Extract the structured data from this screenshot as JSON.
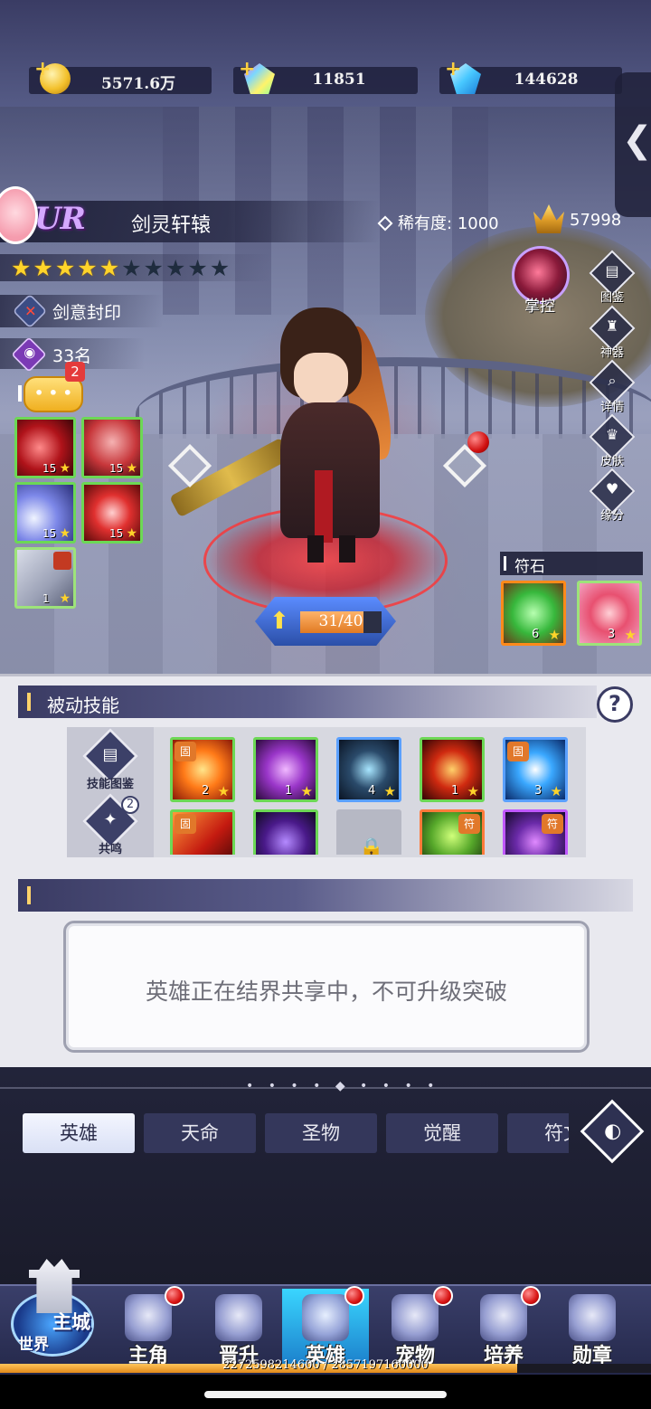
{
  "currency": {
    "gold": "5571.6万",
    "diamond_rainbow": "11851",
    "diamond_blue": "144628"
  },
  "hero": {
    "grade": "UR",
    "name": "剑灵轩辕",
    "rarity_label": "稀有度:",
    "rarity_value": "1000",
    "power": "57998",
    "stars_filled": 5,
    "stars_total": 10,
    "seal": "剑意封印",
    "rank": "33名",
    "chat_badge": "2"
  },
  "active_skills": [
    {
      "level": "15",
      "icon": "red-slash"
    },
    {
      "level": "15",
      "icon": "red-figures"
    },
    {
      "level": "15",
      "icon": "blue-crescent"
    },
    {
      "level": "15",
      "icon": "red-sword"
    },
    {
      "level": "1",
      "icon": "grey-weapon"
    }
  ],
  "exp": {
    "text": "31/40",
    "fraction": 0.775
  },
  "right_menu": {
    "control": "掌控",
    "items": [
      "图鉴",
      "神器",
      "详情",
      "皮肤",
      "缘分"
    ]
  },
  "runes": {
    "title": "符石",
    "items": [
      {
        "count": "6",
        "icon": "green-leaf-rune"
      },
      {
        "count": "3",
        "icon": "red-crystal-rune"
      }
    ]
  },
  "passive": {
    "title": "被动技能",
    "help": "?",
    "side": [
      {
        "label": "技能图鉴",
        "icon": "book-icon"
      },
      {
        "label": "共鸣",
        "icon": "resonance-icon",
        "badge": "2"
      }
    ],
    "row1": [
      {
        "count": "2",
        "tag": "固"
      },
      {
        "count": "1",
        "tag": ""
      },
      {
        "count": "4",
        "tag": ""
      },
      {
        "count": "1",
        "tag": ""
      },
      {
        "count": "3",
        "tag": "固"
      }
    ],
    "row2": [
      {
        "tag": "固"
      },
      {
        "tag": ""
      },
      {
        "tag": ""
      },
      {
        "tag": "符"
      },
      {
        "tag": "符"
      }
    ]
  },
  "notice": "英雄正在结界共享中，不可升级突破",
  "tabs": [
    "英雄",
    "天命",
    "圣物",
    "觉醒",
    "符文"
  ],
  "active_tab": 0,
  "home": {
    "main": "主城",
    "world": "世界"
  },
  "nav": [
    {
      "label": "主角",
      "badge": true
    },
    {
      "label": "晋升",
      "badge": false
    },
    {
      "label": "英雄",
      "badge": true
    },
    {
      "label": "宠物",
      "badge": true
    },
    {
      "label": "培养",
      "badge": true
    },
    {
      "label": "勋章",
      "badge": false
    }
  ],
  "account_exp": {
    "text": "2272598214600 / 2857197160000",
    "fraction": 0.795
  },
  "colors": {
    "accent": "#3ad6ff",
    "star": "#ffd42a",
    "badge": "#d81414"
  }
}
